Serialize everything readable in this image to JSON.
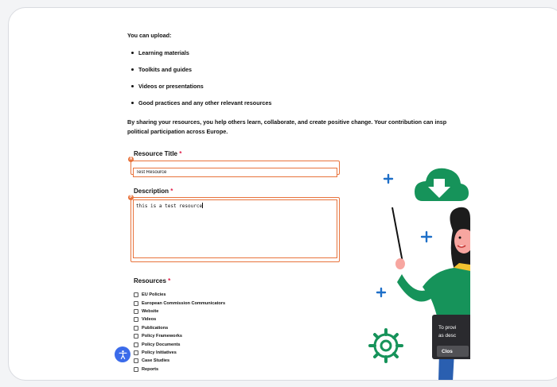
{
  "intro": "You can upload:",
  "upload_types": [
    "Learning materials",
    "Toolkits and guides",
    "Videos or presentations",
    "Good practices and any other relevant resources"
  ],
  "sharing_line1": "By sharing your resources, you help others learn, collaborate, and create positive change. Your contribution can insp",
  "sharing_line2": "political participation across Europe.",
  "form": {
    "required_mark": "*",
    "title_label": "Resource Title",
    "title_marker": "A",
    "title_value": "Test Resource",
    "description_label": "Description",
    "description_marker": "B",
    "description_value": "this is a test resource",
    "resources_label": "Resources",
    "resources": [
      "EU Policies",
      "European Commission Communicators",
      "Website",
      "Videos",
      "Publications",
      "Policy Frameworks",
      "Policy Documents",
      "Policy Initiatives",
      "Case Studies",
      "Reports"
    ]
  },
  "cookie": {
    "line1": "To provi",
    "line2": "as desc",
    "button": "Clos"
  },
  "colors": {
    "accent_orange": "#e8733c",
    "required_red": "#e11d48",
    "illustration_green": "#16935a",
    "plus_blue": "#1e6fc8",
    "a11y_blue": "#3b6bea"
  },
  "icons": [
    "accessibility-icon",
    "cloud-download-icon",
    "gear-icon",
    "plus-icon"
  ]
}
